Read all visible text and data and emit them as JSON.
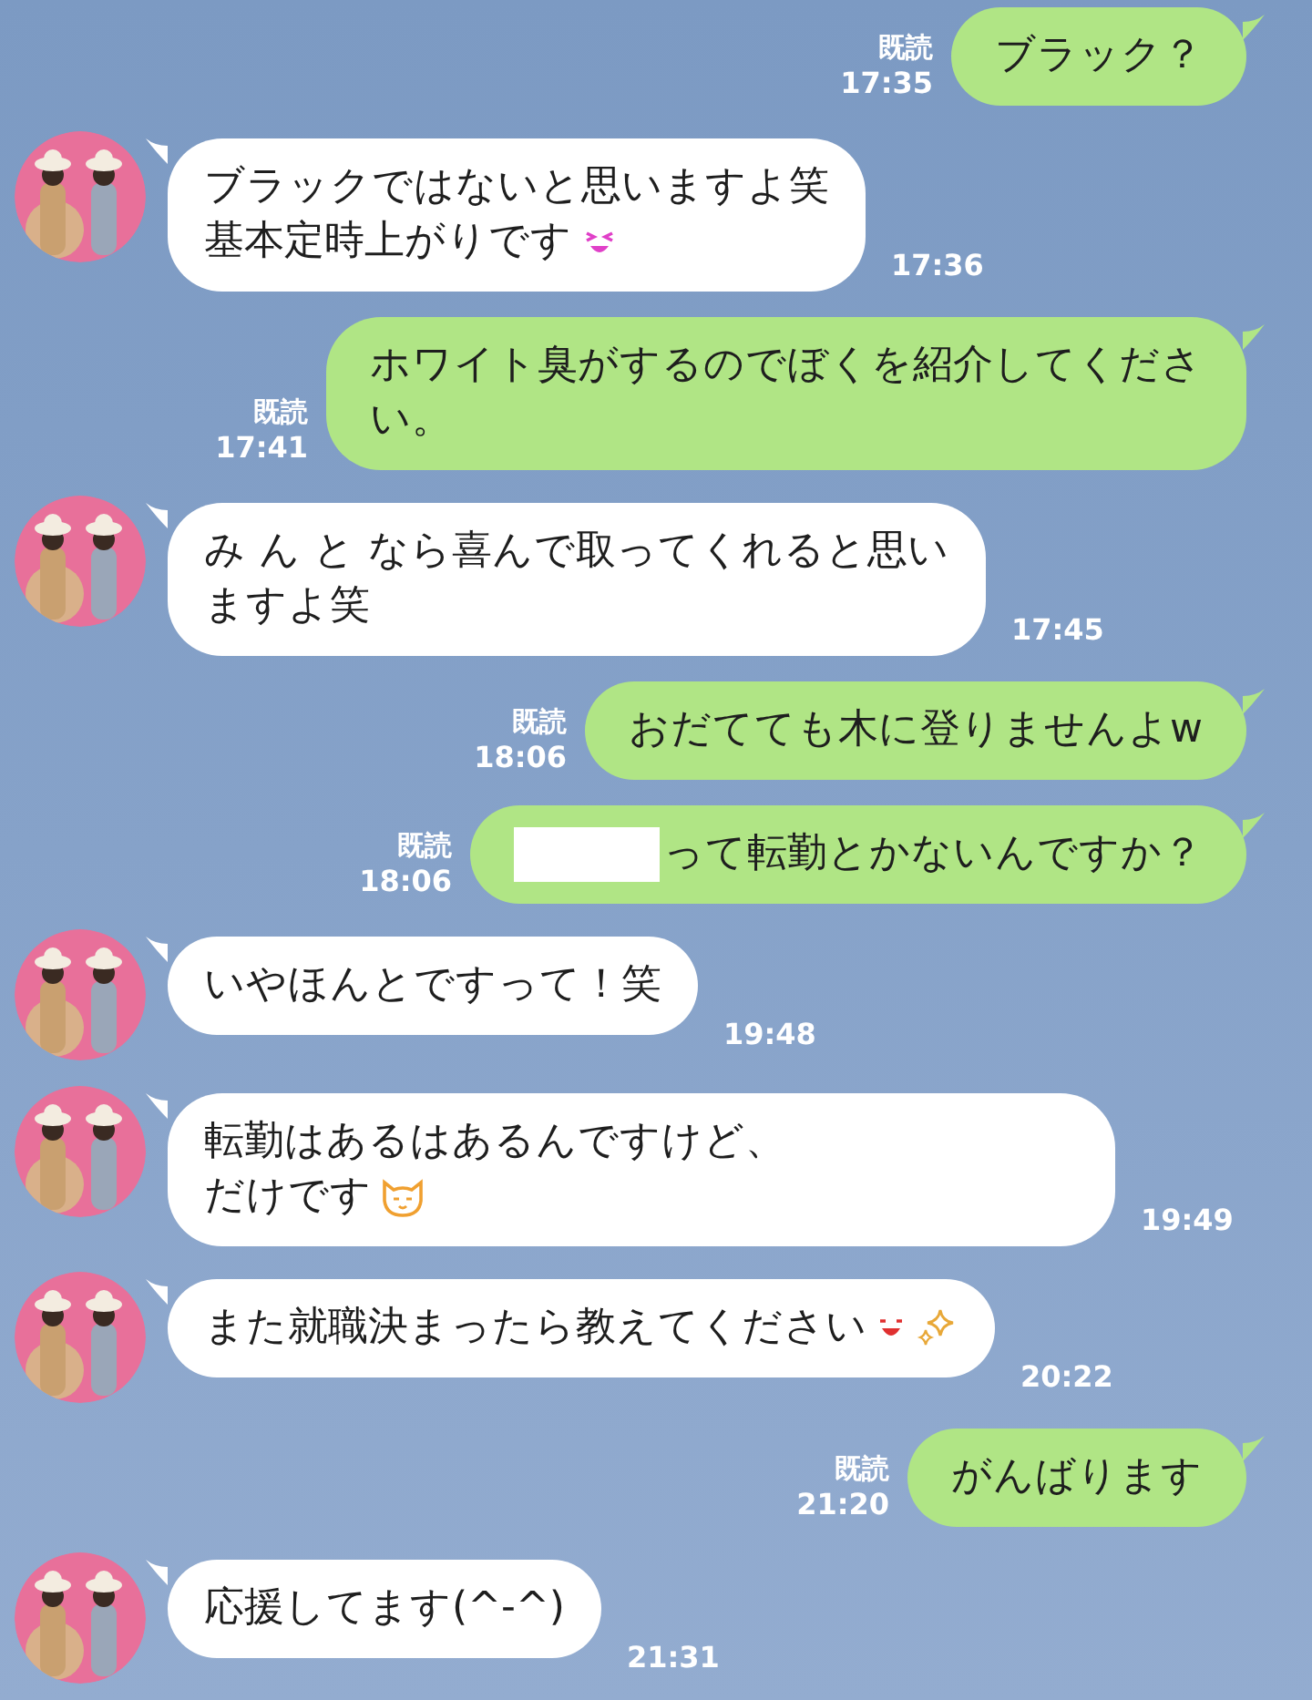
{
  "messages": [
    {
      "kind": "sent",
      "lines": [
        "ブラック？"
      ],
      "read_label": "既読",
      "time": "17:35"
    },
    {
      "kind": "received",
      "lines": [
        "ブラックではないと思いますよ笑",
        "基本定時上がりです"
      ],
      "icons": [
        {
          "kind": "grin-face"
        }
      ],
      "time": "17:36"
    },
    {
      "kind": "sent",
      "lines": [
        "ホワイト臭がするのでぼくを紹介してくださ",
        "い。"
      ],
      "read_label": "既読",
      "time": "17:41"
    },
    {
      "kind": "received",
      "lines": [
        "み ん と なら喜んで取ってくれると思い",
        "ますよ笑"
      ],
      "time": "17:45"
    },
    {
      "kind": "sent",
      "lines": [
        "おだてても木に登りませんよw"
      ],
      "read_label": "既読",
      "time": "18:06"
    },
    {
      "kind": "sent",
      "redacted": true,
      "lines": [
        "って転勤とかないんですか？"
      ],
      "read_label": "既読",
      "time": "18:06"
    },
    {
      "kind": "received",
      "lines": [
        "いやほんとですって！笑"
      ],
      "time": "19:48"
    },
    {
      "kind": "received",
      "lines": [
        "転勤はあるはあるんですけど、",
        "だけです"
      ],
      "icons": [
        {
          "kind": "cat-face"
        }
      ],
      "time": "19:49",
      "wide": true
    },
    {
      "kind": "received",
      "lines": [
        "また就職決まったら教えてください"
      ],
      "icons": [
        {
          "kind": "smile-face"
        },
        {
          "kind": "sparkles"
        }
      ],
      "time": "20:22"
    },
    {
      "kind": "sent",
      "lines": [
        "がんばります"
      ],
      "read_label": "既読",
      "time": "21:20"
    },
    {
      "kind": "received",
      "lines": [
        "応援してます(^-^)"
      ],
      "time": "21:31"
    }
  ]
}
